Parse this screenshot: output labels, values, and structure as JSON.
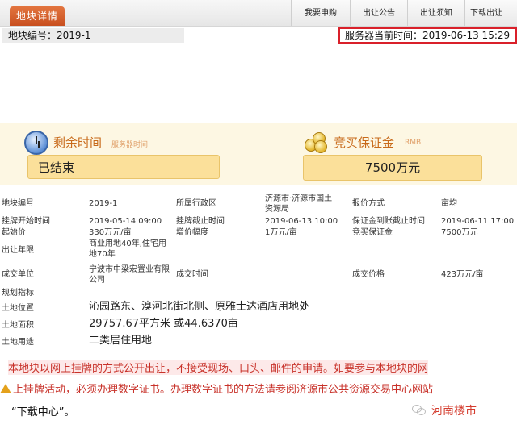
{
  "header": {
    "tab_label": "地块详情",
    "nav": [
      "我要申购",
      "出让公告",
      "出让须知",
      "下载出让"
    ]
  },
  "subheader": {
    "plot_no": "地块编号：2019-1",
    "server_time": "服务器当前时间：2019-06-13 15:29"
  },
  "status": {
    "remaining_label": "剩余时间",
    "remaining_sub": "服务器时间",
    "remaining_value": "已结束",
    "deposit_label": "竞买保证金",
    "deposit_sub": "RMB",
    "deposit_value": "7500万元"
  },
  "details": {
    "plot_no_label": "地块编号",
    "plot_no_value": "2019-1",
    "district_label": "所属行政区",
    "district_value": "济源市·济源市国土资源局",
    "quote_label": "报价方式",
    "quote_value": "亩均",
    "start_label": "挂牌开始时间",
    "start_value": "2019-05-14 09:00",
    "end_label": "挂牌截止时间",
    "end_value": "2019-06-13 10:00",
    "deposit_deadline_label": "保证金到账截止时间",
    "deposit_deadline_value": "2019-06-11 17:00",
    "start_price_label": "起始价",
    "start_price_value": "330万元/亩",
    "increment_label": "增价幅度",
    "increment_value": "1万元/亩",
    "bid_deposit_label": "竞买保证金",
    "bid_deposit_value": "7500万元",
    "term_label": "出让年限",
    "term_value": "商业用地40年,住宅用地70年",
    "winner_label": "成交单位",
    "winner_value": "宁波市中梁宏置业有限公司",
    "deal_time_label": "成交时间",
    "deal_price_label": "成交价格",
    "deal_price_value": "423万元/亩",
    "planning_label": "规划指标",
    "location_label": "土地位置",
    "location_value": "沁园路东、溴河北街北侧、原雅士达酒店用地处",
    "area_label": "土地面积",
    "area_value": "29757.67平方米 或44.6370亩",
    "use_label": "土地用途",
    "use_value": "二类居住用地"
  },
  "notice": {
    "line1": "本地块以网上挂牌的方式公开出让，不接受现场、口头、邮件的申请。如要参与本地块的网",
    "line2": "上挂牌活动，必须办理数字证书。办理数字证书的方法请参阅济源市公共资源交易中心网站",
    "line3": "“下载中心”。"
  },
  "watermark": "河南楼市"
}
